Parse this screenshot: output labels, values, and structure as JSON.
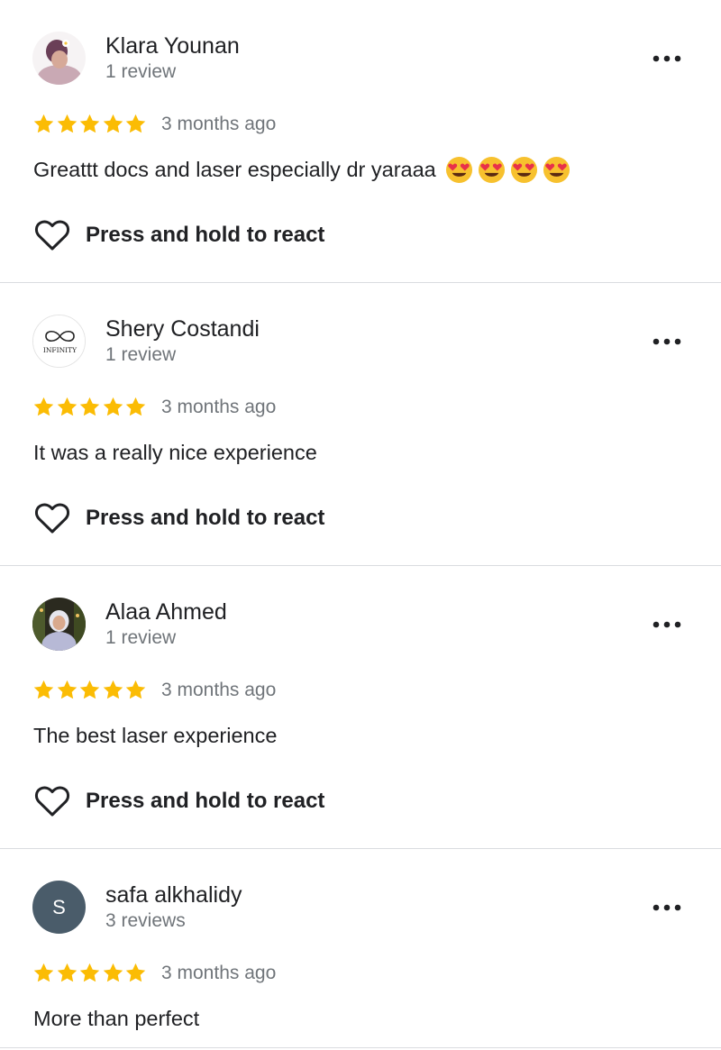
{
  "colors": {
    "star": "#fbbc04",
    "secondary_text": "#70757a",
    "primary_text": "#202124",
    "divider": "#dadce0",
    "letter_avatar_bg": "#4a5c6a"
  },
  "reviews": [
    {
      "reviewer": "Klara Younan",
      "review_count": "1 review",
      "avatar": "photo-avatar",
      "rating": 5,
      "date": "3 months ago",
      "text": "Greattt docs and laser especially dr yaraaa",
      "emojis": [
        "heart-eyes-emoji",
        "heart-eyes-emoji",
        "heart-eyes-emoji",
        "heart-eyes-emoji"
      ],
      "react_label": "Press and hold to react"
    },
    {
      "reviewer": "Shery Costandi",
      "review_count": "1 review",
      "avatar": "infinity-logo-avatar",
      "avatar_text": "INFINITY",
      "rating": 5,
      "date": "3 months ago",
      "text": "It was a really nice experience",
      "react_label": "Press and hold to react"
    },
    {
      "reviewer": "Alaa Ahmed",
      "review_count": "1 review",
      "avatar": "photo-avatar",
      "rating": 5,
      "date": "3 months ago",
      "text": "The best laser experience",
      "react_label": "Press and hold to react"
    },
    {
      "reviewer": "safa alkhalidy",
      "review_count": "3 reviews",
      "avatar": "letter-avatar",
      "avatar_letter": "S",
      "rating": 5,
      "date": "3 months ago",
      "text": "More than perfect"
    }
  ]
}
